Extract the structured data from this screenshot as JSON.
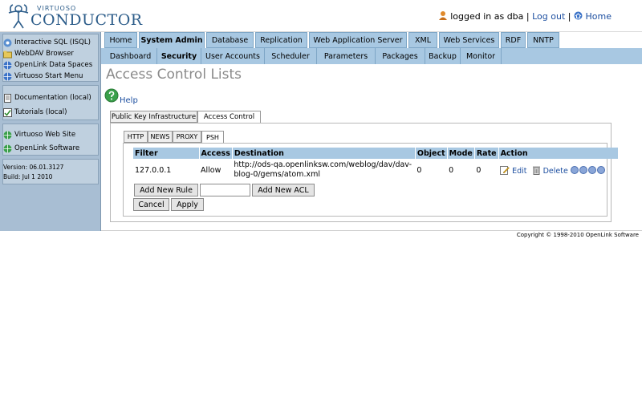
{
  "header": {
    "logo_top": "VIRTUOSO",
    "logo_main": "CONDUCTOR",
    "logged_in": "logged in as dba",
    "sep1": "|",
    "logout": "Log out",
    "sep2": "|",
    "home": "Home"
  },
  "sidebar": {
    "groups": [
      {
        "items": [
          "Interactive SQL (ISQL)",
          "WebDAV Browser",
          "OpenLink Data Spaces",
          "Virtuoso Start Menu"
        ]
      },
      {
        "items": [
          "Documentation (local)",
          "Tutorials (local)"
        ]
      },
      {
        "items": [
          "Virtuoso Web Site",
          "OpenLink Software"
        ]
      }
    ],
    "version": "Version: 06.01.3127",
    "build": "Build: Jul 1 2010"
  },
  "nav": {
    "tabs": [
      "Home",
      "System Admin",
      "Database",
      "Replication",
      "Web Application Server",
      "XML",
      "Web Services",
      "RDF",
      "NNTP"
    ],
    "active_tab": "System Admin",
    "subtabs": [
      "Dashboard",
      "Security",
      "User Accounts",
      "Scheduler",
      "Parameters",
      "Packages",
      "Backup",
      "Monitor"
    ],
    "active_subtab": "Security"
  },
  "page": {
    "title": "Access Control Lists",
    "help": "Help"
  },
  "section_tabs": [
    "Public Key Infrastructure",
    "Access Control"
  ],
  "protocol_tabs": [
    "HTTP",
    "NEWS",
    "PROXY",
    "PSH"
  ],
  "table": {
    "headers": [
      "Filter",
      "Access",
      "Destination",
      "Object",
      "Mode",
      "Rate",
      "Action"
    ],
    "rows": [
      {
        "filter": "127.0.0.1",
        "access": "Allow",
        "destination_line1": "http://ods-qa.openlinksw.com/weblog/dav/dav-",
        "destination_line2": "blog-0/gems/atom.xml",
        "object": "0",
        "mode": "0",
        "rate": "0",
        "edit": "Edit",
        "delete": "Delete"
      }
    ]
  },
  "buttons": {
    "add_rule": "Add New Rule",
    "add_acl": "Add New ACL",
    "cancel": "Cancel",
    "apply": "Apply"
  },
  "footer": {
    "copyright": "Copyright © 1998-2010 OpenLink Software"
  },
  "colors": {
    "tab_bg": "#a8c8e2",
    "sidebar_bg": "#a8bed3",
    "link": "#1d4fa0"
  }
}
